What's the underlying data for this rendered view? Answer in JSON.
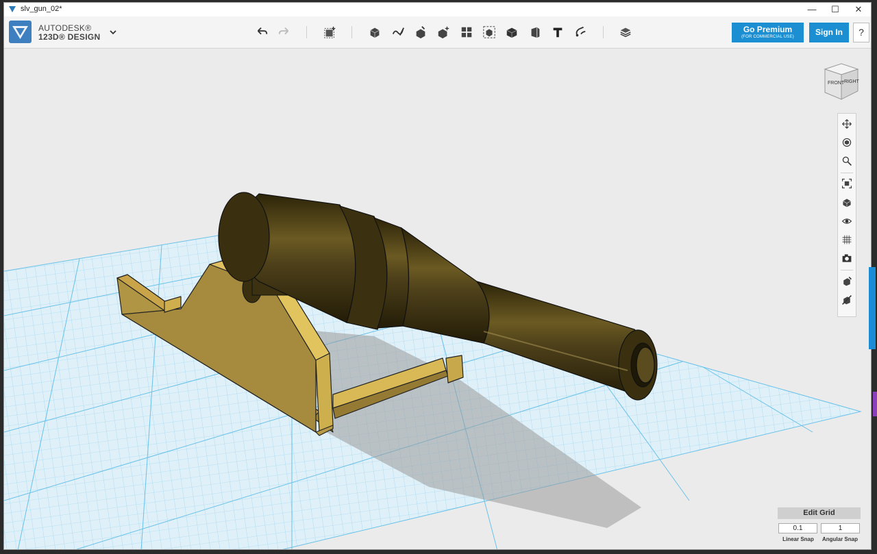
{
  "window": {
    "title": "slv_gun_02*",
    "minimize": "—",
    "maximize": "☐",
    "close": "✕"
  },
  "brand": {
    "line1": "AUTODESK®",
    "line2": "123D® DESIGN",
    "logo_icon": "autodesk-123d-logo-icon",
    "menu_icon": "chevron-down-icon"
  },
  "toolbar": {
    "tools": [
      {
        "name": "undo-icon"
      },
      {
        "name": "redo-icon"
      },
      {
        "name": "transform-icon"
      },
      {
        "name": "primitives-icon"
      },
      {
        "name": "sketch-icon"
      },
      {
        "name": "construct-icon"
      },
      {
        "name": "modify-icon"
      },
      {
        "name": "pattern-icon"
      },
      {
        "name": "grouping-icon"
      },
      {
        "name": "combine-icon"
      },
      {
        "name": "measure-icon"
      },
      {
        "name": "text-icon"
      },
      {
        "name": "snap-icon"
      },
      {
        "name": "material-icon"
      }
    ],
    "premium": {
      "label": "Go Premium",
      "sublabel": "(FOR COMMERCIAL USE)"
    },
    "signin_label": "Sign In",
    "help_label": "?"
  },
  "viewcube": {
    "front": "FRONT",
    "right": "RIGHT"
  },
  "nav": [
    {
      "name": "pan-icon"
    },
    {
      "name": "orbit-icon"
    },
    {
      "name": "zoom-icon"
    },
    {
      "name": "fit-icon"
    },
    {
      "name": "view-mode-icon"
    },
    {
      "name": "visibility-icon"
    },
    {
      "name": "grid-visibility-icon"
    },
    {
      "name": "camera-icon"
    },
    {
      "name": "material-view-icon"
    },
    {
      "name": "hide-materials-icon"
    }
  ],
  "grid_panel": {
    "edit_grid": "Edit Grid",
    "linear_snap_value": "0.1",
    "angular_snap_value": "1",
    "linear_snap_label": "Linear Snap",
    "angular_snap_label": "Angular Snap"
  },
  "colors": {
    "accent": "#1b8fd1",
    "grid_line": "#6ec4ea",
    "grid_fill": "#d9eef8",
    "barrel": "#4a3d14",
    "carriage": "#c9a449"
  }
}
